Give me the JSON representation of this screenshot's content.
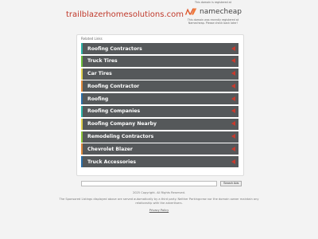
{
  "domain": "trailblazerhomesolutions.com",
  "promo": {
    "top_text": "This domain is registered at",
    "brand": "namecheap",
    "bottom_text": "This domain was recently registered at Namecheap. Please check back later!"
  },
  "related_links": {
    "heading": "Related Links",
    "items": [
      {
        "label": "Roofing Contractors",
        "color": "#2bb3a6"
      },
      {
        "label": "Truck Tires",
        "color": "#6cbf3a"
      },
      {
        "label": "Car Tires",
        "color": "#e1d14d"
      },
      {
        "label": "Roofing Contractor",
        "color": "#e08a3c"
      },
      {
        "label": "Roofing",
        "color": "#2b6fa8"
      },
      {
        "label": "Roofing Companies",
        "color": "#2bb3a6"
      },
      {
        "label": "Roofing Company Nearby",
        "color": "#e1d14d"
      },
      {
        "label": "Remodeling Contractors",
        "color": "#8fc43a"
      },
      {
        "label": "Chevrolet Blazer",
        "color": "#e08a3c"
      },
      {
        "label": "Truck Accessories",
        "color": "#2b6fa8"
      }
    ]
  },
  "search": {
    "placeholder": "",
    "button_label": "Search Ads"
  },
  "footer": {
    "copyright": "2025 Copyright. All Rights Reserved.",
    "disclaimer": "The Sponsored Listings displayed above are served automatically by a third party. Neither Parkingcrew nor the domain owner maintain any relationship with the advertisers.",
    "privacy": "Privacy Policy"
  },
  "colors": {
    "accent": "#c0392b",
    "item_bg": "#55585a",
    "arrow": "#c83a2d"
  }
}
